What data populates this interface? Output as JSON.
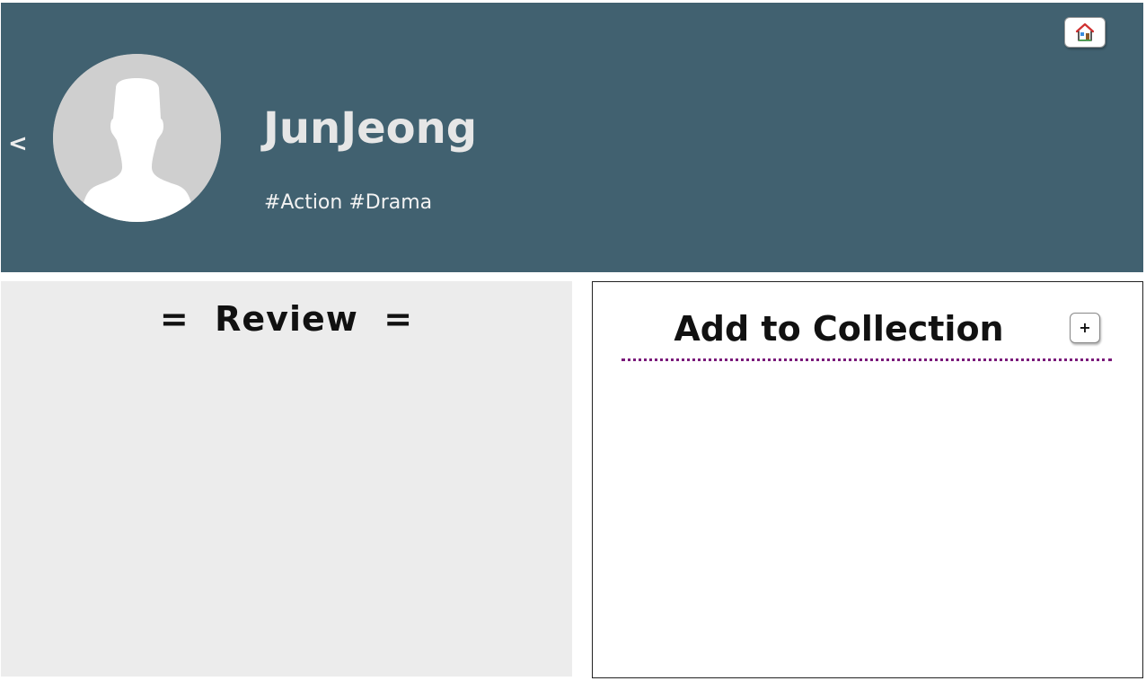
{
  "header": {
    "back_label": "<",
    "avatar_icon": "user-silhouette-icon",
    "username": "JunJeong",
    "tags": "#Action #Drama",
    "home_icon": "house-icon",
    "background_color": "#416170"
  },
  "review": {
    "title": "=  Review  ="
  },
  "collection": {
    "title": "Add to Collection",
    "add_label": "+",
    "divider_color": "#7a1a7a"
  }
}
